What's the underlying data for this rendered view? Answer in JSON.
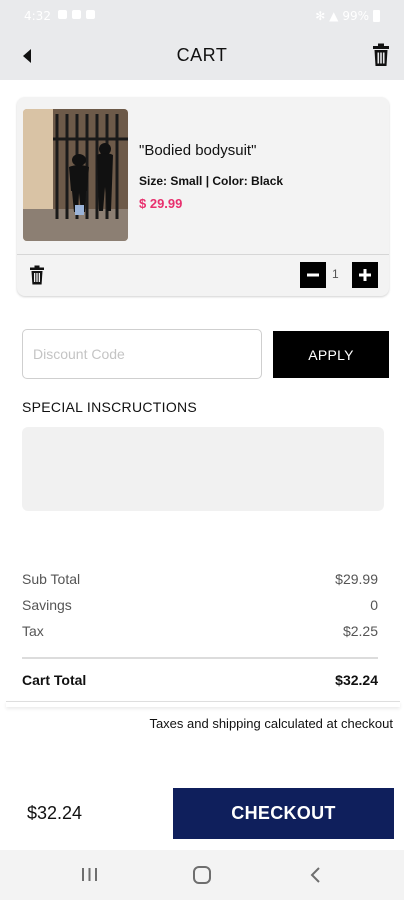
{
  "status_bar": {
    "time": "4:32",
    "battery": "99%"
  },
  "header": {
    "title": "CART"
  },
  "cart_item": {
    "name": "\"Bodied bodysuit\"",
    "specs": "Size: Small | Color: Black",
    "price": "$ 29.99",
    "quantity": "1",
    "price_color": "#e8306e"
  },
  "discount": {
    "placeholder": "Discount Code",
    "value": "",
    "apply_label": "APPLY"
  },
  "special_instructions": {
    "label": "SPECIAL INSCRUCTIONS",
    "value": ""
  },
  "summary": {
    "subtotal_label": "Sub Total",
    "subtotal": "$29.99",
    "savings_label": "Savings",
    "savings": "0",
    "tax_label": "Tax",
    "tax": "$2.25",
    "total_label": "Cart Total",
    "total": "$32.24"
  },
  "tax_note": "Taxes and shipping calculated at checkout",
  "footer": {
    "total": "$32.24",
    "checkout_label": "CHECKOUT",
    "checkout_color": "#0f1f5c"
  },
  "icons": [
    "back-arrow-icon",
    "trash-icon",
    "minus-icon",
    "plus-icon",
    "recents-icon",
    "home-icon",
    "nav-back-icon"
  ]
}
